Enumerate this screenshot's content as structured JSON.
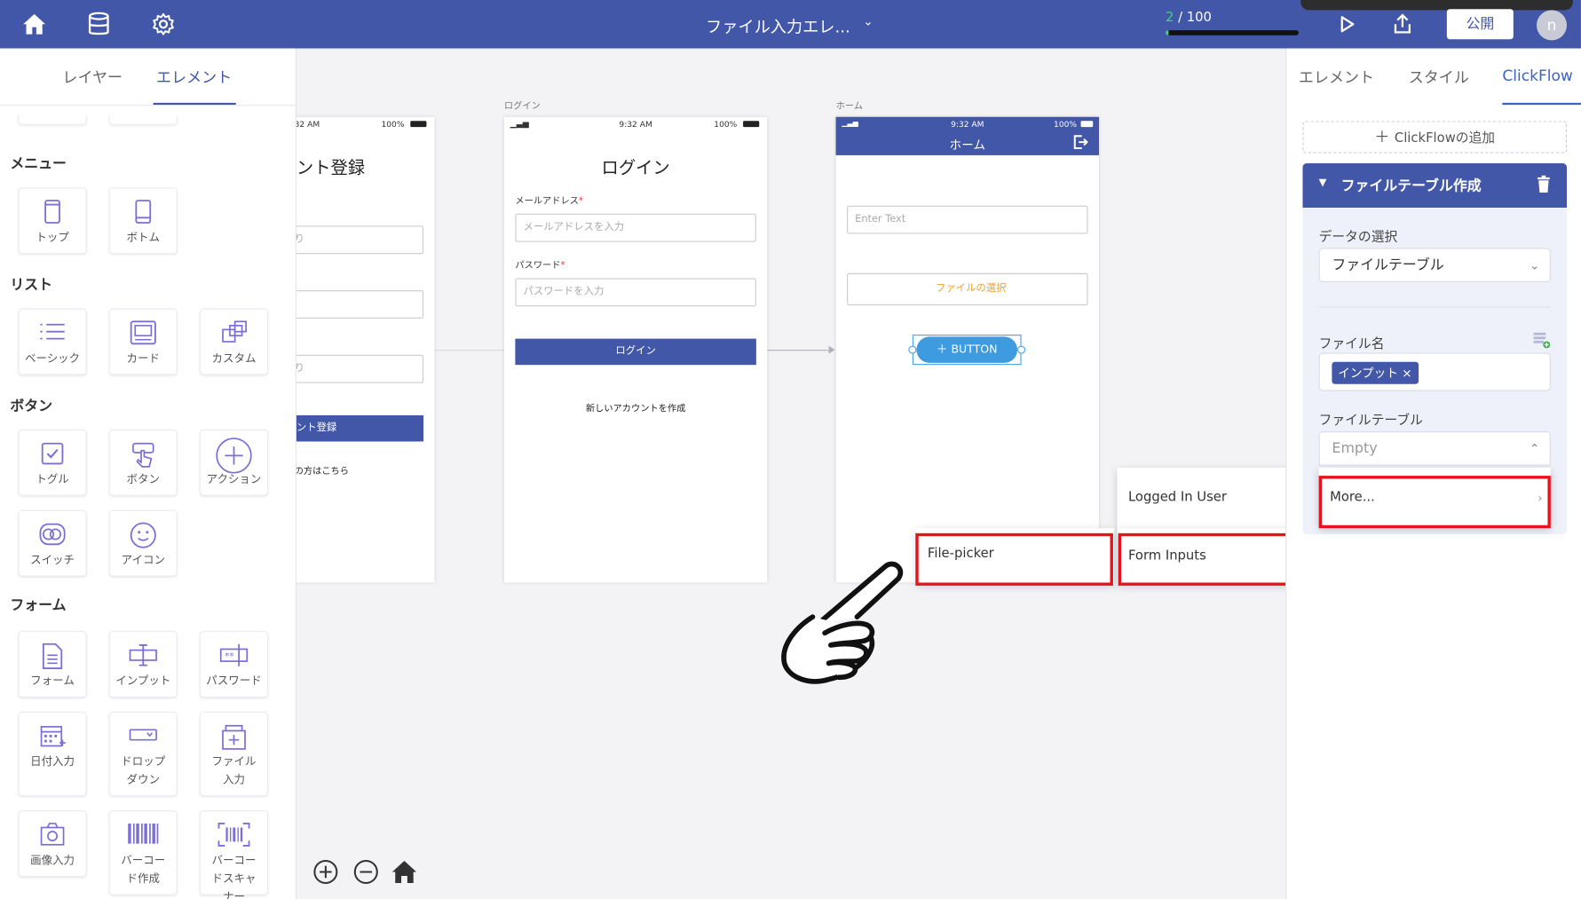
{
  "header": {
    "title": "ファイル入力エレ...",
    "progress_current": "2",
    "progress_total": "/ 100",
    "progress_fraction": 0.02,
    "publish_label": "公開",
    "avatar_initial": "n"
  },
  "left_panel": {
    "tabs": [
      "レイヤー",
      "エレメント"
    ],
    "sections": {
      "menu": "メニュー",
      "list": "リスト",
      "button": "ボタン",
      "form": "フォーム"
    },
    "tiles": {
      "top": "トップ",
      "bottom": "ボトム",
      "basic": "ベーシック",
      "card": "カード",
      "custom": "カスタム",
      "toggle": "トグル",
      "button": "ボタン",
      "action": "アクション",
      "switch": "スイッチ",
      "icon": "アイコン",
      "form": "フォーム",
      "input": "インプット",
      "password": "パスワード",
      "date": "日付入力",
      "dropdown": "ドロップダウン",
      "file_input": "ファイル入力",
      "image_input": "画像入力",
      "barcode_create": "バーコード作成",
      "barcode_scanner": "バーコードスキャナー"
    }
  },
  "canvas": {
    "register_screen": {
      "time": "32 AM",
      "battery": "100%",
      "title": "ント登録",
      "field1_hint": "り",
      "field3_hint": "り",
      "button": "ント登録",
      "link": "の方はこちら"
    },
    "login_screen": {
      "label": "ログイン",
      "time": "9:32 AM",
      "battery": "100%",
      "title": "ログイン",
      "email_label": "メールアドレス",
      "email_placeholder": "メールアドレスを入力",
      "password_label": "パスワード",
      "password_placeholder": "パスワードを入力",
      "required_mark": "*",
      "button": "ログイン",
      "create_account": "新しいアカウントを作成"
    },
    "home_screen": {
      "label": "ホーム",
      "time": "9:32 AM",
      "battery": "100%",
      "title": "ホーム",
      "text_placeholder": "Enter Text",
      "file_select": "ファイルの選択",
      "button": "＋ BUTTON"
    }
  },
  "context_menu": {
    "file_picker": "File-picker",
    "logged_in_user": "Logged In User",
    "form_inputs": "Form Inputs",
    "more": "More..."
  },
  "right_panel": {
    "tabs": [
      "エレメント",
      "スタイル",
      "ClickFlow"
    ],
    "add_clickflow": "ClickFlowの追加",
    "flow_title": "ファイルテーブル作成",
    "data_select_label": "データの選択",
    "data_select_value": "ファイルテーブル",
    "file_name_label": "ファイル名",
    "file_name_chip": "インプット",
    "file_table_label": "ファイルテーブル",
    "file_table_value": "Empty"
  },
  "colors": {
    "primary": "#4257a8",
    "highlight": "#e8121c",
    "accent_link": "#3a63c7",
    "file_select_text": "#f0a030"
  }
}
